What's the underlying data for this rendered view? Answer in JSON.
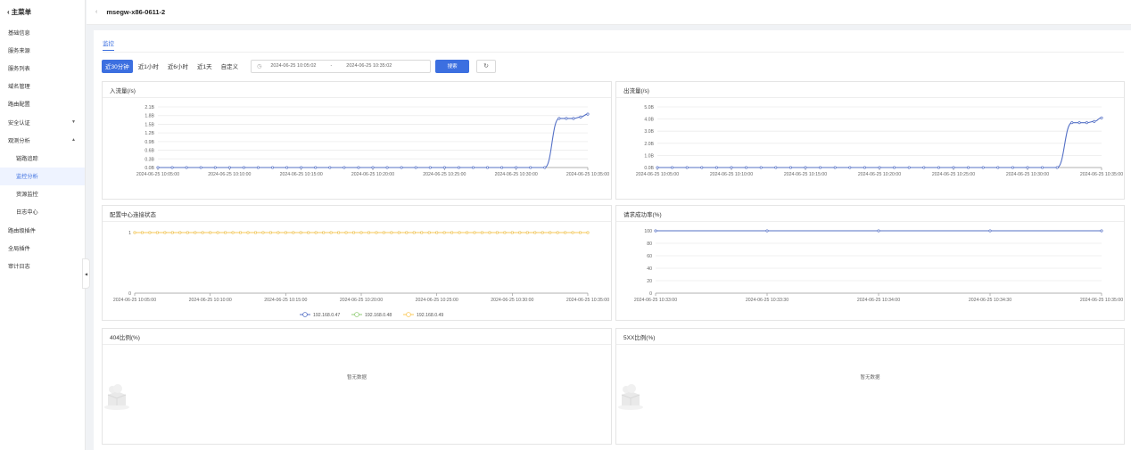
{
  "sidebar": {
    "back_label": "主菜单",
    "items": [
      {
        "label": "基础信息"
      },
      {
        "label": "服务来源"
      },
      {
        "label": "服务列表"
      },
      {
        "label": "域名管理"
      },
      {
        "label": "路由配置"
      },
      {
        "label": "安全认证",
        "expandable": true,
        "expanded": false
      },
      {
        "label": "观测分析",
        "expandable": true,
        "expanded": true
      },
      {
        "label": "链路追踪",
        "sub": true
      },
      {
        "label": "监控分析",
        "sub": true,
        "active": true
      },
      {
        "label": "资源监控",
        "sub": true
      },
      {
        "label": "日志中心",
        "sub": true
      },
      {
        "label": "路由级插件"
      },
      {
        "label": "全局插件"
      },
      {
        "label": "审计日志"
      }
    ]
  },
  "header": {
    "instance_name": "msegw-x86-0611-2"
  },
  "tabs": [
    {
      "label": "监控",
      "active": true
    }
  ],
  "toolbar": {
    "ranges": [
      {
        "label": "近30分钟",
        "active": true
      },
      {
        "label": "近1小时"
      },
      {
        "label": "近6小时"
      },
      {
        "label": "近1天"
      },
      {
        "label": "自定义"
      }
    ],
    "start": "2024-06-25 10:05:02",
    "separator": "-",
    "end": "2024-06-25 10:35:02",
    "search_label": "搜索"
  },
  "colors": {
    "accent": "#3c6fe0",
    "series_blue": "#5470c6",
    "series_green": "#91cc75",
    "series_yellow": "#fac858"
  },
  "cards": {
    "inbound": {
      "title": "入流量(/s)"
    },
    "outbound": {
      "title": "出流量(/s)"
    },
    "config": {
      "title": "配置中心连接状态"
    },
    "success": {
      "title": "请求成功率(%)"
    },
    "ratio404": {
      "title": "404比例(%)",
      "empty_text": "暂无数据"
    },
    "ratio5xx": {
      "title": "5XX比例(%)",
      "empty_text": "暂无数据"
    }
  },
  "chart_data": [
    {
      "id": "inbound",
      "type": "line",
      "y_ticks": [
        "0.0B",
        "0.3B",
        "0.6B",
        "0.9B",
        "1.2B",
        "1.5B",
        "1.8B",
        "2.1B"
      ],
      "ylim": [
        0,
        2.1
      ],
      "x_ticks": [
        "2024-06-25 10:05:00",
        "2024-06-25 10:10:00",
        "2024-06-25 10:15:00",
        "2024-06-25 10:20:00",
        "2024-06-25 10:25:00",
        "2024-06-25 10:30:00",
        "2024-06-25 10:35:00"
      ],
      "x_range": [
        0,
        30
      ],
      "series": [
        {
          "color": "#5470c6",
          "points": [
            [
              0,
              0
            ],
            [
              1,
              0
            ],
            [
              2,
              0
            ],
            [
              3,
              0
            ],
            [
              4,
              0
            ],
            [
              5,
              0
            ],
            [
              6,
              0
            ],
            [
              7,
              0
            ],
            [
              8,
              0
            ],
            [
              9,
              0
            ],
            [
              10,
              0
            ],
            [
              11,
              0
            ],
            [
              12,
              0
            ],
            [
              13,
              0
            ],
            [
              14,
              0
            ],
            [
              15,
              0
            ],
            [
              16,
              0
            ],
            [
              17,
              0
            ],
            [
              18,
              0
            ],
            [
              19,
              0
            ],
            [
              20,
              0
            ],
            [
              21,
              0
            ],
            [
              22,
              0
            ],
            [
              23,
              0
            ],
            [
              24,
              0
            ],
            [
              25,
              0
            ],
            [
              26,
              0
            ],
            [
              27,
              0
            ],
            [
              28,
              1.7
            ],
            [
              28.5,
              1.7
            ],
            [
              29,
              1.7
            ],
            [
              29.5,
              1.75
            ],
            [
              30,
              1.85
            ]
          ]
        }
      ]
    },
    {
      "id": "outbound",
      "type": "line",
      "y_ticks": [
        "0.0B",
        "1.0B",
        "2.0B",
        "3.0B",
        "4.0B",
        "5.0B"
      ],
      "ylim": [
        0,
        5
      ],
      "x_ticks": [
        "2024-06-25 10:05:00",
        "2024-06-25 10:10:00",
        "2024-06-25 10:15:00",
        "2024-06-25 10:20:00",
        "2024-06-25 10:25:00",
        "2024-06-25 10:30:00",
        "2024-06-25 10:35:00"
      ],
      "x_range": [
        0,
        30
      ],
      "series": [
        {
          "color": "#5470c6",
          "points": [
            [
              0,
              0
            ],
            [
              1,
              0
            ],
            [
              2,
              0
            ],
            [
              3,
              0
            ],
            [
              4,
              0
            ],
            [
              5,
              0
            ],
            [
              6,
              0
            ],
            [
              7,
              0
            ],
            [
              8,
              0
            ],
            [
              9,
              0
            ],
            [
              10,
              0
            ],
            [
              11,
              0
            ],
            [
              12,
              0
            ],
            [
              13,
              0
            ],
            [
              14,
              0
            ],
            [
              15,
              0
            ],
            [
              16,
              0
            ],
            [
              17,
              0
            ],
            [
              18,
              0
            ],
            [
              19,
              0
            ],
            [
              20,
              0
            ],
            [
              21,
              0
            ],
            [
              22,
              0
            ],
            [
              23,
              0
            ],
            [
              24,
              0
            ],
            [
              25,
              0
            ],
            [
              26,
              0
            ],
            [
              27,
              0
            ],
            [
              28,
              3.7
            ],
            [
              28.5,
              3.7
            ],
            [
              29,
              3.7
            ],
            [
              29.5,
              3.8
            ],
            [
              30,
              4.1
            ]
          ]
        }
      ]
    },
    {
      "id": "config",
      "type": "line",
      "y_ticks": [
        "0",
        "1"
      ],
      "ylim": [
        0,
        1
      ],
      "x_ticks": [
        "2024-06-25 10:05:00",
        "2024-06-25 10:10:00",
        "2024-06-25 10:15:00",
        "2024-06-25 10:20:00",
        "2024-06-25 10:25:00",
        "2024-06-25 10:30:00",
        "2024-06-25 10:35:00"
      ],
      "x_range": [
        0,
        30
      ],
      "legend": [
        "192.168.0.47",
        "192.168.0.48",
        "192.168.0.49"
      ],
      "series": [
        {
          "name": "192.168.0.47",
          "color": "#5470c6",
          "constant": 1
        },
        {
          "name": "192.168.0.48",
          "color": "#91cc75",
          "constant": 1
        },
        {
          "name": "192.168.0.49",
          "color": "#fac858",
          "constant": 1
        }
      ]
    },
    {
      "id": "success",
      "type": "line",
      "y_ticks": [
        "0",
        "20",
        "40",
        "60",
        "80",
        "100"
      ],
      "ylim": [
        0,
        100
      ],
      "x_ticks": [
        "2024-06-25 10:33:00",
        "2024-06-25 10:33:30",
        "2024-06-25 10:34:00",
        "2024-06-25 10:34:30",
        "2024-06-25 10:35:00"
      ],
      "x_range": [
        0,
        4
      ],
      "series": [
        {
          "color": "#5470c6",
          "points": [
            [
              0,
              100
            ],
            [
              1,
              100
            ],
            [
              2,
              100
            ],
            [
              3,
              100
            ],
            [
              4,
              100
            ]
          ]
        }
      ]
    }
  ]
}
